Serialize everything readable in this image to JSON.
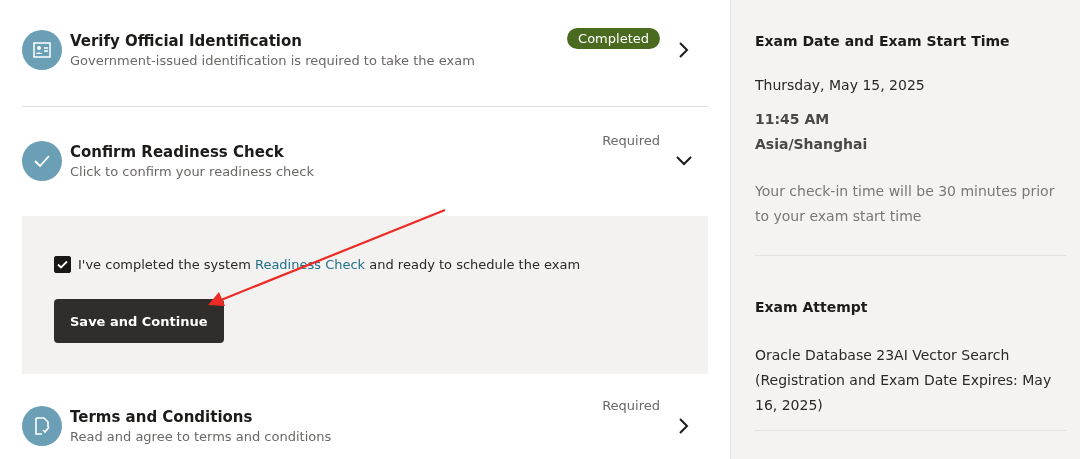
{
  "steps": [
    {
      "title": "Verify Official Identification",
      "description": "Government-issued identification is required to take the exam",
      "status": "Completed",
      "kind": "badge",
      "expanded": false
    },
    {
      "title": "Confirm Readiness Check",
      "description": "Click to confirm your readiness check",
      "status": "Required",
      "kind": "text",
      "expanded": true,
      "confirmation": {
        "checked": true,
        "text_before": "I've completed the system",
        "link": "Readiness Check",
        "text_after": "and ready to schedule the exam"
      },
      "button": "Save and Continue"
    },
    {
      "title": "Terms and Conditions",
      "description": "Read and agree to terms and conditions",
      "status": "Required",
      "kind": "text",
      "expanded": false
    }
  ],
  "summary": {
    "sections": [
      {
        "heading": "Exam Date and Exam Start Time",
        "date": "Thursday, May 15, 2025",
        "time": "11:45 AM",
        "timezone": "Asia/Shanghai",
        "note": "Your check-in time will be 30 minutes prior to your exam start time"
      },
      {
        "heading": "Exam Attempt",
        "body": "Oracle Database 23AI Vector Search (Registration and Exam Date Expires: May 16, 2025)"
      }
    ]
  }
}
